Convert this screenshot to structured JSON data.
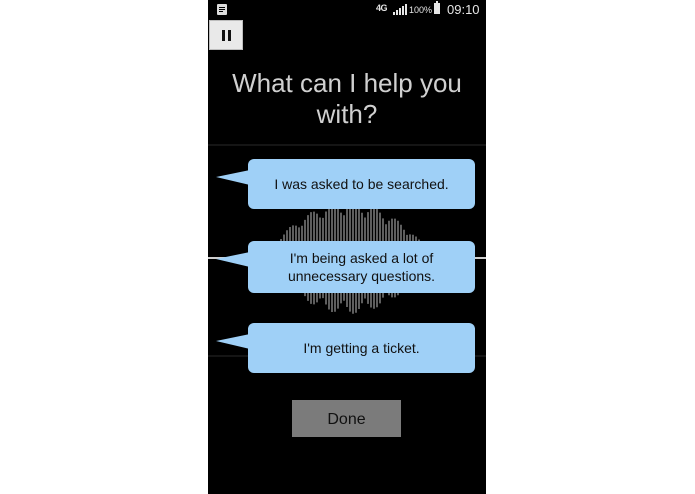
{
  "status_bar": {
    "network": "4G",
    "battery": "100%",
    "time": "09:10",
    "icons": [
      "notification-icon",
      "signal-icon",
      "battery-icon"
    ]
  },
  "toolbar": {
    "pause_icon": "pause-icon"
  },
  "prompt": {
    "title": "What can I help you with?"
  },
  "options": [
    {
      "label": "I was asked to be searched."
    },
    {
      "label": "I'm being asked a lot of unnecessary questions."
    },
    {
      "label": "I'm getting a ticket."
    }
  ],
  "done_label": "Done",
  "colors": {
    "screen_bg": "#000000",
    "bubble": "#9fd0f7",
    "title_text": "#d0d0d0",
    "done_button": "#7b7b7b",
    "pause_button": "#e9e9e9"
  }
}
